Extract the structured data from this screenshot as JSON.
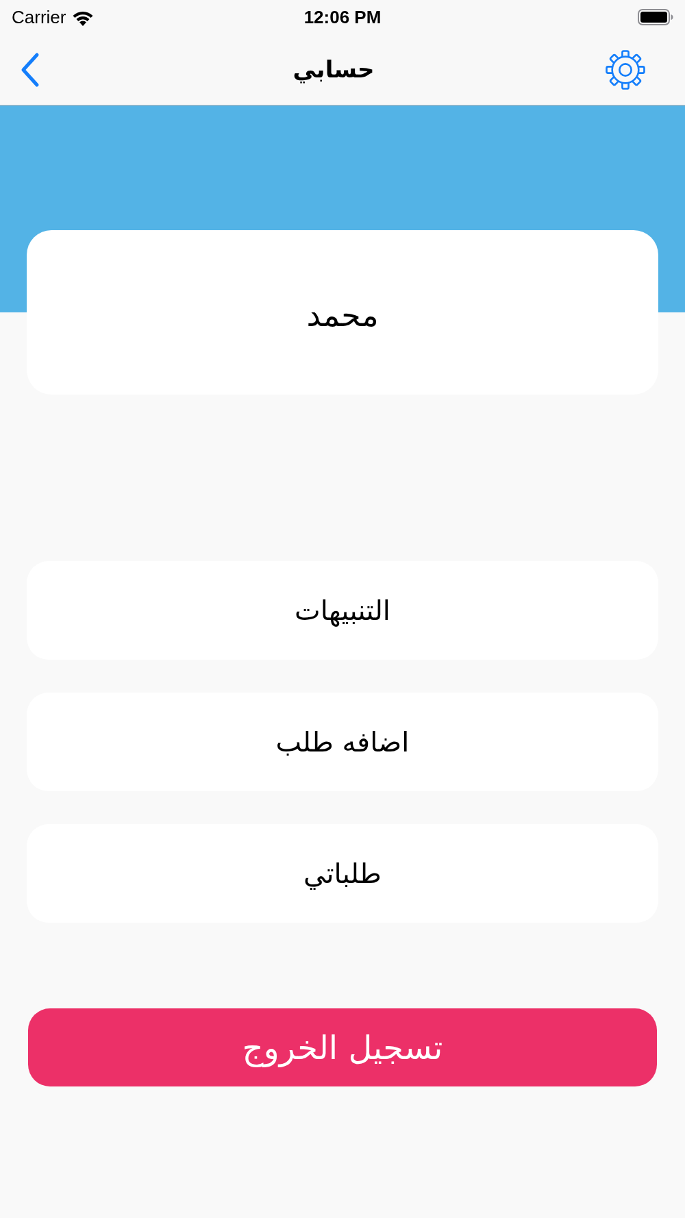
{
  "status_bar": {
    "carrier": "Carrier",
    "time": "12:06 PM"
  },
  "nav_bar": {
    "title": "حسابي"
  },
  "profile_card": {
    "name": "محمد"
  },
  "menu_items": [
    {
      "label": "التنبيهات"
    },
    {
      "label": "اضافه طلب"
    },
    {
      "label": "طلباتي"
    }
  ],
  "logout_button": {
    "label": "تسجيل الخروج"
  }
}
